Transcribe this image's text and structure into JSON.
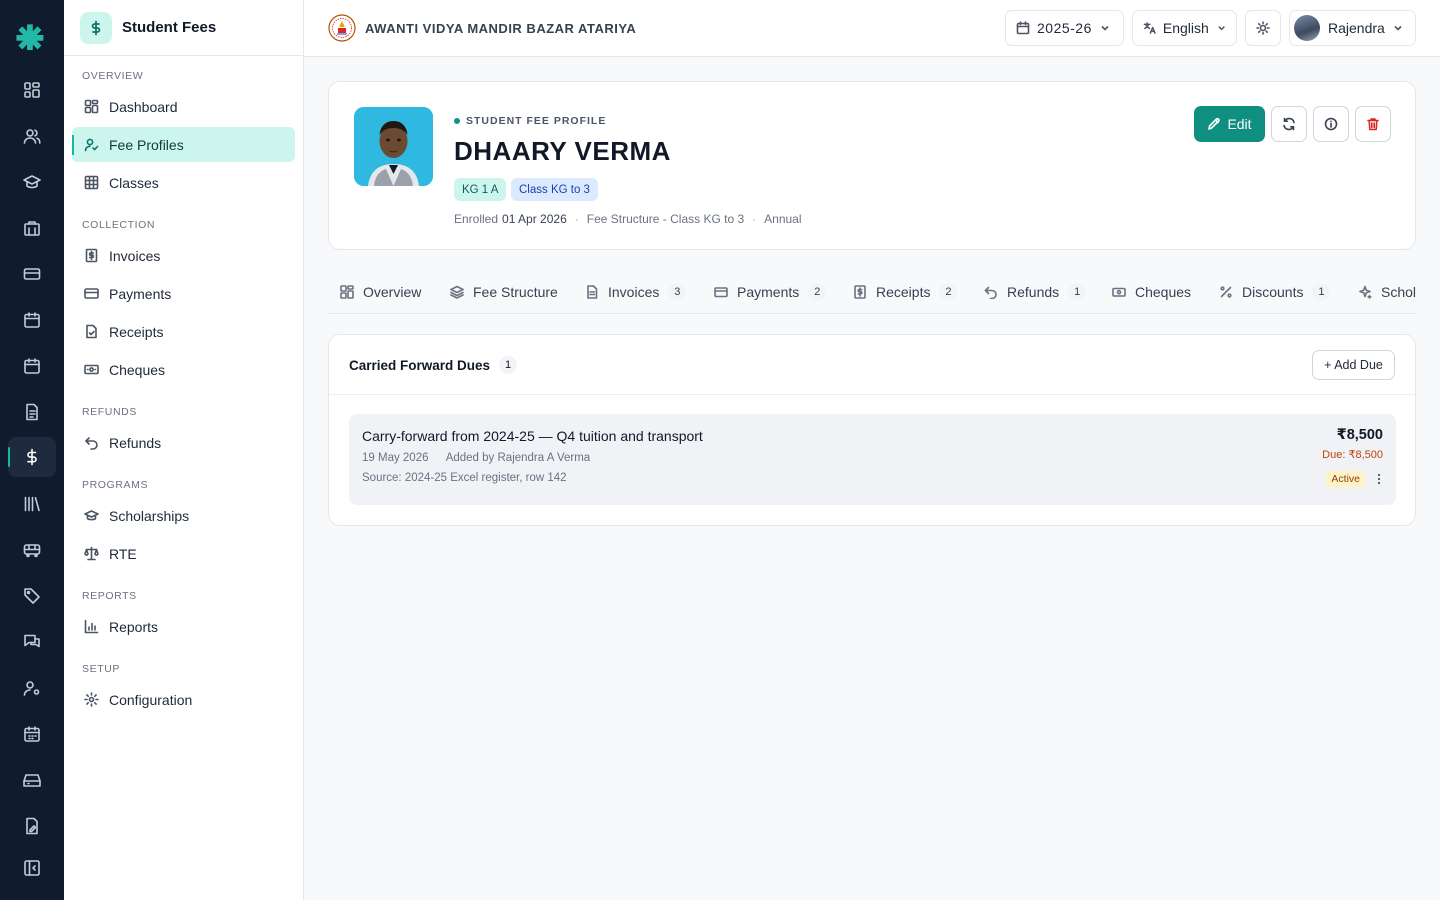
{
  "sidebar": {
    "title": "Student Fees",
    "sections": {
      "overview": "Overview",
      "collection": "Collection",
      "refunds": "Refunds",
      "programs": "Programs",
      "reports": "Reports",
      "setup": "Setup"
    },
    "items": {
      "dashboard": "Dashboard",
      "fee_profiles": "Fee Profiles",
      "classes": "Classes",
      "invoices": "Invoices",
      "payments": "Payments",
      "receipts": "Receipts",
      "cheques": "Cheques",
      "refunds": "Refunds",
      "scholarships": "Scholarships",
      "rte": "RTE",
      "reports": "Reports",
      "configuration": "Configuration"
    },
    "active": "fee_profiles"
  },
  "topbar": {
    "school_name": "AWANTI VIDYA MANDIR BAZAR ATARIYA",
    "academic_year": "2025-26",
    "language": "English",
    "user_name": "Rajendra"
  },
  "profile": {
    "eyebrow": "STUDENT FEE PROFILE",
    "name": "DHAARY VERMA",
    "section_chip": "KG 1 A",
    "class_chip": "Class KG to 3",
    "enrolled_label": "Enrolled",
    "enrolled_date": "01 Apr 2026",
    "fee_structure": "Fee Structure - Class KG to 3",
    "frequency": "Annual",
    "edit_label": "Edit"
  },
  "tabs": [
    {
      "label": "Overview",
      "count": null,
      "icon": "grid-icon"
    },
    {
      "label": "Fee Structure",
      "count": null,
      "icon": "layers-icon"
    },
    {
      "label": "Invoices",
      "count": "3",
      "icon": "document-icon"
    },
    {
      "label": "Payments",
      "count": "2",
      "icon": "card-icon"
    },
    {
      "label": "Receipts",
      "count": "2",
      "icon": "receipt-icon"
    },
    {
      "label": "Refunds",
      "count": "1",
      "icon": "undo-icon"
    },
    {
      "label": "Cheques",
      "count": null,
      "icon": "banknote-icon"
    },
    {
      "label": "Discounts",
      "count": "1",
      "icon": "percent-icon"
    },
    {
      "label": "Schol",
      "count": null,
      "icon": "sparkle-icon"
    }
  ],
  "dues": {
    "title": "Carried Forward Dues",
    "count": "1",
    "add_label": "+ Add Due",
    "items": [
      {
        "description": "Carry-forward from 2024-25 — Q4 tuition and transport",
        "date": "19 May 2026",
        "added_by": "Added by Rajendra A Verma",
        "source": "Source: 2024-25 Excel register, row 142",
        "amount": "₹8,500",
        "due": "Due: ₹8,500",
        "status": "Active"
      }
    ]
  },
  "colors": {
    "rail_bg": "#101b2d",
    "accent": "#0f8f7f",
    "accent_light": "#ccf5ee",
    "danger": "#dc2626",
    "status_active_bg": "#fef3c7"
  }
}
